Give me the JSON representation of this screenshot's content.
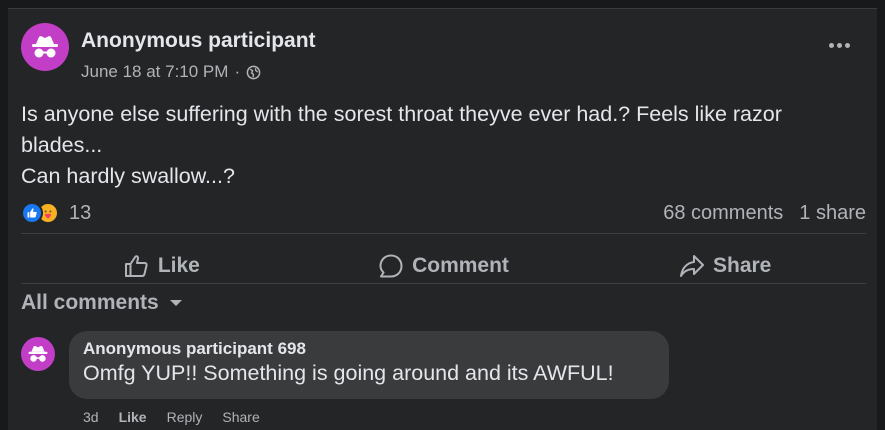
{
  "post": {
    "author": "Anonymous participant",
    "date": "June 18 at 7:10 PM",
    "separator": "·",
    "privacy_icon": "globe-icon",
    "text_lines": [
      "Is anyone else suffering with the sorest throat theyve ever had.? Feels like razor",
      "blades...",
      "Can hardly swallow...?"
    ],
    "reactions": {
      "icons": [
        "like-icon",
        "care-icon"
      ],
      "count": "13"
    },
    "comments_count": "68 comments",
    "shares_count": "1 share"
  },
  "actions": {
    "like_label": "Like",
    "comment_label": "Comment",
    "share_label": "Share"
  },
  "comments_filter": {
    "label": "All comments"
  },
  "comments": [
    {
      "author": "Anonymous participant 698",
      "text": "Omfg YUP!! Something is going around and its AWFUL!",
      "time": "3d",
      "like_label": "Like",
      "reply_label": "Reply",
      "share_label": "Share"
    }
  ],
  "colors": {
    "background": "#18191a",
    "card": "#242526",
    "avatar": "#c23ec7",
    "like_blue": "#1877f2",
    "bubble": "#3a3b3c",
    "text_primary": "#e4e6eb",
    "text_secondary": "#b0b3b8"
  }
}
